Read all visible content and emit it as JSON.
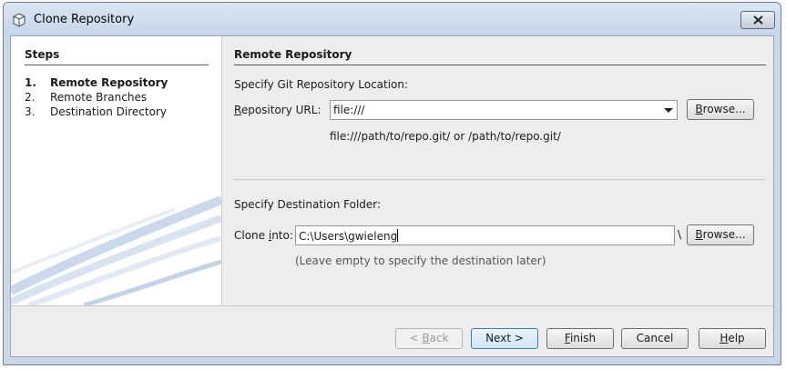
{
  "window": {
    "title": "Clone Repository",
    "close_label": "close"
  },
  "steps": {
    "title": "Steps",
    "items": [
      {
        "num": "1.",
        "label": "Remote Repository",
        "active": true
      },
      {
        "num": "2.",
        "label": "Remote Branches",
        "active": false
      },
      {
        "num": "3.",
        "label": "Destination Directory",
        "active": false
      }
    ]
  },
  "main": {
    "title": "Remote Repository",
    "git_location_label": "Specify Git Repository Location:",
    "repo_url_label_mnemonic": "R",
    "repo_url_label_rest": "epository URL:",
    "repo_url_value": "file:///",
    "browse_label_mnemonic": "B",
    "browse_label_rest": "rowse...",
    "url_hint": "file:///path/to/repo.git/  or  /path/to/repo.git/",
    "dest_folder_label": "Specify Destination Folder:",
    "clone_into_label_pre": "Clone ",
    "clone_into_label_mnemonic": "i",
    "clone_into_label_post": "nto:",
    "clone_into_value": "C:\\Users\\gwieleng",
    "path_sep": "\\",
    "dest_hint": "(Leave empty to specify the destination later)"
  },
  "buttons": {
    "back_pre": "< ",
    "back_mnemonic": "B",
    "back_post": "ack",
    "next": "Next >",
    "finish_mnemonic": "F",
    "finish_rest": "inish",
    "cancel": "Cancel",
    "help_mnemonic": "H",
    "help_rest": "elp"
  }
}
